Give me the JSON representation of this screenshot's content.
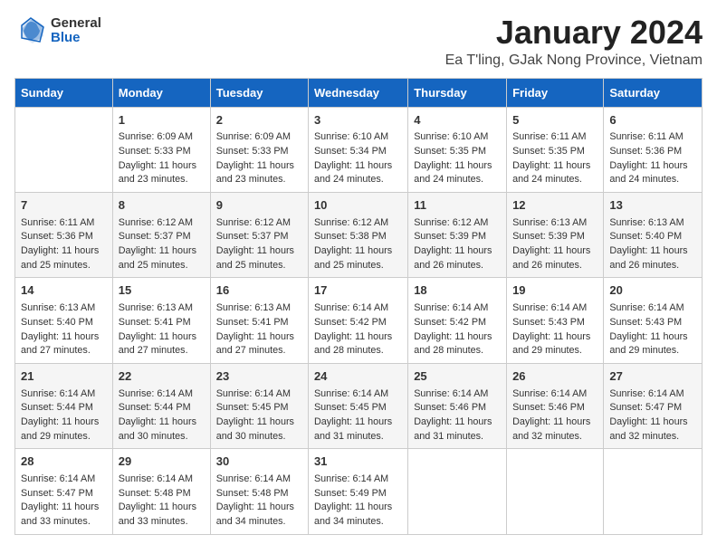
{
  "logo": {
    "general": "General",
    "blue": "Blue"
  },
  "title": "January 2024",
  "subtitle": "Ea T'ling, GJak Nong Province, Vietnam",
  "days_of_week": [
    "Sunday",
    "Monday",
    "Tuesday",
    "Wednesday",
    "Thursday",
    "Friday",
    "Saturday"
  ],
  "weeks": [
    [
      {
        "day": null,
        "info": null
      },
      {
        "day": "1",
        "sunrise": "6:09 AM",
        "sunset": "5:33 PM",
        "daylight": "11 hours and 23 minutes."
      },
      {
        "day": "2",
        "sunrise": "6:09 AM",
        "sunset": "5:33 PM",
        "daylight": "11 hours and 23 minutes."
      },
      {
        "day": "3",
        "sunrise": "6:10 AM",
        "sunset": "5:34 PM",
        "daylight": "11 hours and 24 minutes."
      },
      {
        "day": "4",
        "sunrise": "6:10 AM",
        "sunset": "5:35 PM",
        "daylight": "11 hours and 24 minutes."
      },
      {
        "day": "5",
        "sunrise": "6:11 AM",
        "sunset": "5:35 PM",
        "daylight": "11 hours and 24 minutes."
      },
      {
        "day": "6",
        "sunrise": "6:11 AM",
        "sunset": "5:36 PM",
        "daylight": "11 hours and 24 minutes."
      }
    ],
    [
      {
        "day": "7",
        "sunrise": "6:11 AM",
        "sunset": "5:36 PM",
        "daylight": "11 hours and 25 minutes."
      },
      {
        "day": "8",
        "sunrise": "6:12 AM",
        "sunset": "5:37 PM",
        "daylight": "11 hours and 25 minutes."
      },
      {
        "day": "9",
        "sunrise": "6:12 AM",
        "sunset": "5:37 PM",
        "daylight": "11 hours and 25 minutes."
      },
      {
        "day": "10",
        "sunrise": "6:12 AM",
        "sunset": "5:38 PM",
        "daylight": "11 hours and 25 minutes."
      },
      {
        "day": "11",
        "sunrise": "6:12 AM",
        "sunset": "5:39 PM",
        "daylight": "11 hours and 26 minutes."
      },
      {
        "day": "12",
        "sunrise": "6:13 AM",
        "sunset": "5:39 PM",
        "daylight": "11 hours and 26 minutes."
      },
      {
        "day": "13",
        "sunrise": "6:13 AM",
        "sunset": "5:40 PM",
        "daylight": "11 hours and 26 minutes."
      }
    ],
    [
      {
        "day": "14",
        "sunrise": "6:13 AM",
        "sunset": "5:40 PM",
        "daylight": "11 hours and 27 minutes."
      },
      {
        "day": "15",
        "sunrise": "6:13 AM",
        "sunset": "5:41 PM",
        "daylight": "11 hours and 27 minutes."
      },
      {
        "day": "16",
        "sunrise": "6:13 AM",
        "sunset": "5:41 PM",
        "daylight": "11 hours and 27 minutes."
      },
      {
        "day": "17",
        "sunrise": "6:14 AM",
        "sunset": "5:42 PM",
        "daylight": "11 hours and 28 minutes."
      },
      {
        "day": "18",
        "sunrise": "6:14 AM",
        "sunset": "5:42 PM",
        "daylight": "11 hours and 28 minutes."
      },
      {
        "day": "19",
        "sunrise": "6:14 AM",
        "sunset": "5:43 PM",
        "daylight": "11 hours and 29 minutes."
      },
      {
        "day": "20",
        "sunrise": "6:14 AM",
        "sunset": "5:43 PM",
        "daylight": "11 hours and 29 minutes."
      }
    ],
    [
      {
        "day": "21",
        "sunrise": "6:14 AM",
        "sunset": "5:44 PM",
        "daylight": "11 hours and 29 minutes."
      },
      {
        "day": "22",
        "sunrise": "6:14 AM",
        "sunset": "5:44 PM",
        "daylight": "11 hours and 30 minutes."
      },
      {
        "day": "23",
        "sunrise": "6:14 AM",
        "sunset": "5:45 PM",
        "daylight": "11 hours and 30 minutes."
      },
      {
        "day": "24",
        "sunrise": "6:14 AM",
        "sunset": "5:45 PM",
        "daylight": "11 hours and 31 minutes."
      },
      {
        "day": "25",
        "sunrise": "6:14 AM",
        "sunset": "5:46 PM",
        "daylight": "11 hours and 31 minutes."
      },
      {
        "day": "26",
        "sunrise": "6:14 AM",
        "sunset": "5:46 PM",
        "daylight": "11 hours and 32 minutes."
      },
      {
        "day": "27",
        "sunrise": "6:14 AM",
        "sunset": "5:47 PM",
        "daylight": "11 hours and 32 minutes."
      }
    ],
    [
      {
        "day": "28",
        "sunrise": "6:14 AM",
        "sunset": "5:47 PM",
        "daylight": "11 hours and 33 minutes."
      },
      {
        "day": "29",
        "sunrise": "6:14 AM",
        "sunset": "5:48 PM",
        "daylight": "11 hours and 33 minutes."
      },
      {
        "day": "30",
        "sunrise": "6:14 AM",
        "sunset": "5:48 PM",
        "daylight": "11 hours and 34 minutes."
      },
      {
        "day": "31",
        "sunrise": "6:14 AM",
        "sunset": "5:49 PM",
        "daylight": "11 hours and 34 minutes."
      },
      {
        "day": null,
        "info": null
      },
      {
        "day": null,
        "info": null
      },
      {
        "day": null,
        "info": null
      }
    ]
  ],
  "labels": {
    "sunrise": "Sunrise:",
    "sunset": "Sunset:",
    "daylight": "Daylight:"
  }
}
